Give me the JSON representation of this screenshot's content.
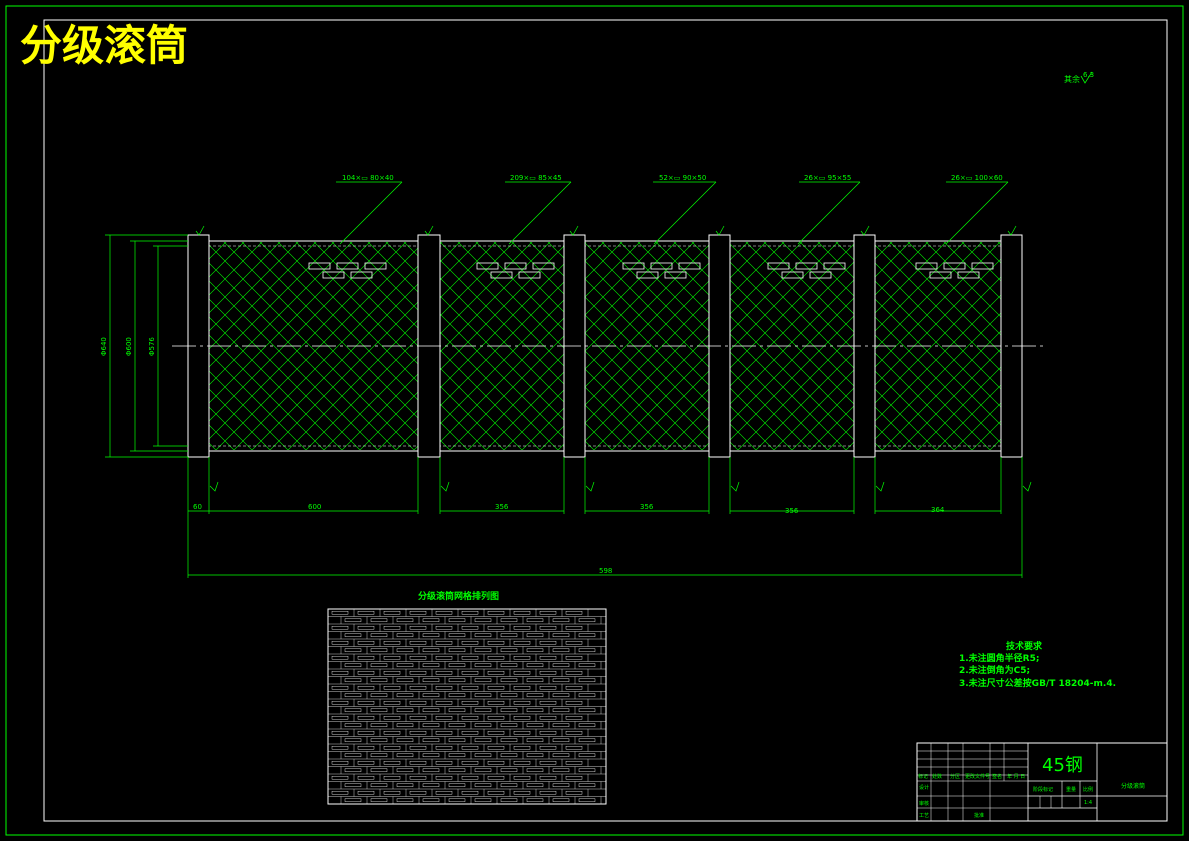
{
  "title": "分级滚筒",
  "roughness_note": "其余",
  "roughness_value": "6.3",
  "drum_sections": [
    {
      "hole_spec": "104×▭ 80×40",
      "length": "600"
    },
    {
      "hole_spec": "209×▭ 85×45",
      "length": "356"
    },
    {
      "hole_spec": "52×▭ 90×50",
      "length": "356"
    },
    {
      "hole_spec": "26×▭ 95×55",
      "length": "356"
    },
    {
      "hole_spec": "26×▭ 100×60",
      "length": "364"
    }
  ],
  "diameters": [
    "Φ640",
    "Φ600",
    "Φ576"
  ],
  "end_length": "60",
  "total_length": "598",
  "section_roughness": "6.3",
  "pattern_title": "分级滚筒网格排列图",
  "tech_requirements": {
    "heading": "技术要求",
    "items": [
      "1.未注圆角半径R5;",
      "2.未注倒角为C5;",
      "3.未注尺寸公差按GB/T 18204-m.4."
    ]
  },
  "title_block": {
    "material": "45钢",
    "part_name": "分级滚筒",
    "row_labels": [
      "标记",
      "处数",
      "分区",
      "更改文件号",
      "签名",
      "年 月 日"
    ],
    "designer_label": "设计",
    "review_label": "审核",
    "process_label": "工艺",
    "approve_label": "批准",
    "stage_label": "阶段标记",
    "weight_label": "重量",
    "scale_label": "比例",
    "scale_value": "1:4"
  },
  "colors": {
    "line": "#00ff00",
    "title": "#ffff00",
    "outline": "#ffffff",
    "background": "#000000"
  }
}
